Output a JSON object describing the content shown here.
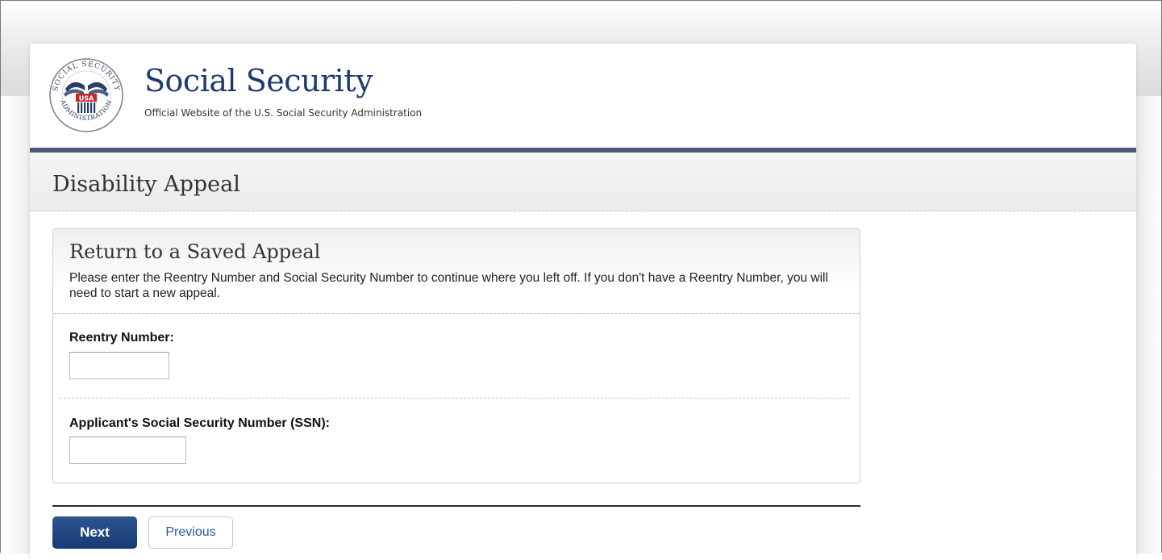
{
  "header": {
    "title": "Social Security",
    "subtitle": "Official Website of the U.S. Social Security Administration",
    "seal": {
      "ring_top": "SOCIAL SECURITY",
      "ring_bottom": "ADMINISTRATION",
      "center": "USA"
    }
  },
  "page": {
    "title": "Disability Appeal"
  },
  "panel": {
    "title": "Return to a Saved Appeal",
    "description": "Please enter the Reentry Number and Social Security Number to continue where you left off. If you don't have a Reentry Number, you will need to start a new appeal.",
    "fields": [
      {
        "label": "Reentry Number:",
        "value": ""
      },
      {
        "label": "Applicant's Social Security Number (SSN):",
        "value": ""
      }
    ]
  },
  "actions": {
    "next_label": "Next",
    "previous_label": "Previous"
  },
  "colors": {
    "brand_blue": "#1f3b6e",
    "header_rule": "#4a5a78",
    "button_primary": "#1f4580",
    "link_blue": "#1f5ea8",
    "seal_red": "#c62828"
  },
  "icons": {
    "seal": "ssa-seal-icon"
  }
}
